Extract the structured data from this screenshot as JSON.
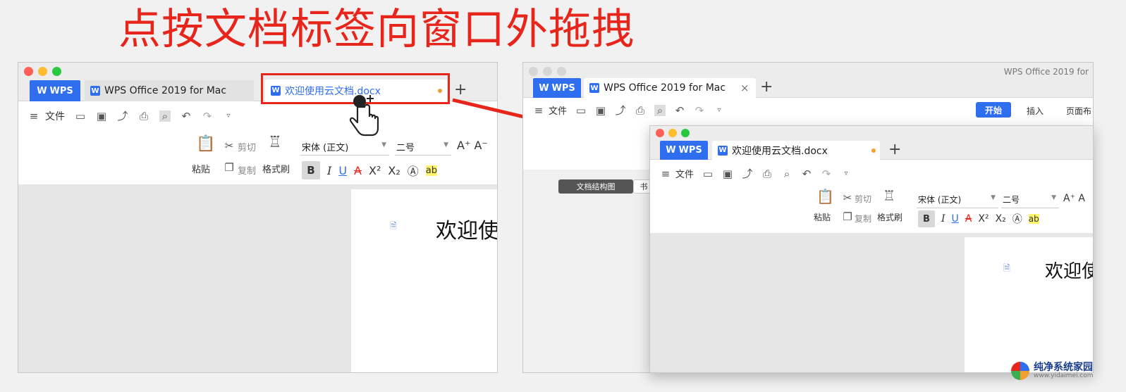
{
  "headline": "点按文档标签向窗口外拖拽",
  "colors": {
    "accent": "#e8251b",
    "brand": "#2f6fef",
    "tab_dot": "#f0a030"
  },
  "left_window": {
    "tabs": {
      "wps": "WPS",
      "app_tab": "WPS Office 2019 for Mac",
      "doc_tab": "欢迎使用云文档.docx"
    },
    "toolbar": {
      "menu_label": "文件"
    },
    "ribbon": {
      "cut": "剪切",
      "paste": "粘贴",
      "copy": "复制",
      "format_painter": "格式刷",
      "font_name": "宋体 (正文)",
      "font_size": "二号"
    },
    "page_title": "欢迎使"
  },
  "right_window": {
    "title": "WPS Office 2019 for",
    "tabs": {
      "wps": "WPS",
      "app_tab": "WPS Office 2019 for Mac"
    },
    "toolbar": {
      "menu_label": "文件",
      "start": "开始",
      "insert": "插入",
      "layout": "页面布"
    },
    "structure_tab": "文档结构图",
    "structure_tab2": "书"
  },
  "floating_window": {
    "tabs": {
      "wps": "WPS",
      "doc_tab": "欢迎使用云文档.docx"
    },
    "toolbar": {
      "menu_label": "文件"
    },
    "ribbon": {
      "cut": "剪切",
      "paste": "粘贴",
      "copy": "复制",
      "format_painter": "格式刷",
      "font_name": "宋体 (正文)",
      "font_size": "二号"
    },
    "page_title": "欢迎使"
  },
  "watermark": {
    "name": "纯净系统家园",
    "url": "www.yidaimei.com"
  }
}
